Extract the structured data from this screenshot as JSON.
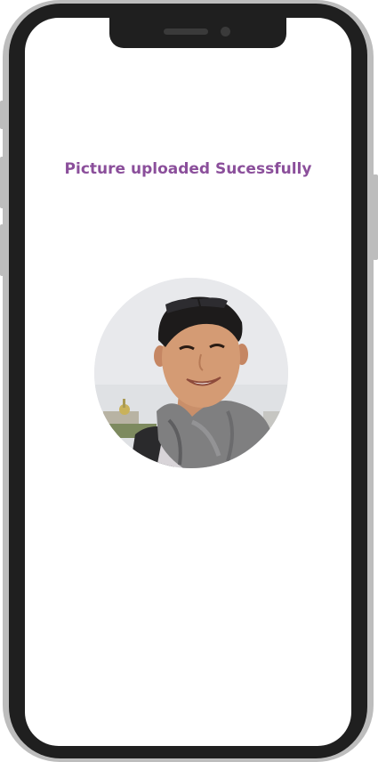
{
  "status": {
    "message": "Picture uploaded Sucessfully"
  },
  "profile_photo": {
    "alt": "Uploaded profile picture of a smiling man wearing sunglasses on his head and a grey scarf"
  },
  "colors": {
    "accent": "#8b4f9b",
    "device_frame": "#1f1f1f",
    "device_edge": "#bdbdbd",
    "screen_bg": "#ffffff"
  }
}
